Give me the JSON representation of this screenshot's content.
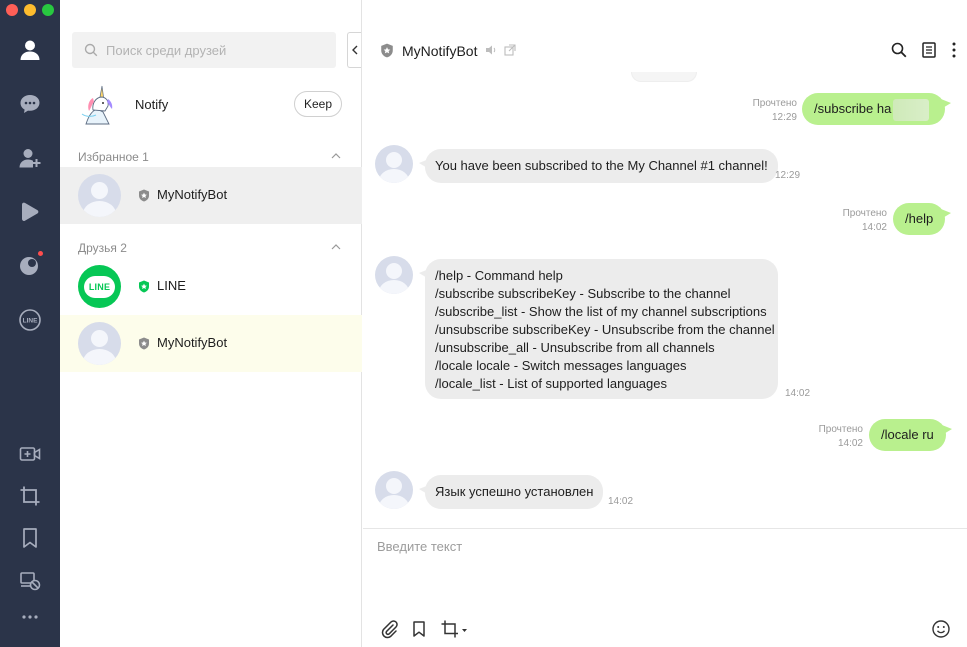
{
  "colors": {
    "rail_bg": "#2b3449",
    "rail_icon": "#a7adbd",
    "rail_active": "#ffffff",
    "out_bubble": "#b9f08e",
    "in_bubble": "#ececec",
    "line_green": "#06c755",
    "notification_dot": "#ff4d4d"
  },
  "rail": {
    "icons": [
      "friends-icon",
      "chats-icon",
      "add-friend-icon",
      "timeline-icon",
      "openchat-icon",
      "line-icon",
      "video-call-icon",
      "screenshot-icon",
      "keep-icon",
      "mute-icon",
      "more-icon"
    ]
  },
  "friends": {
    "search_placeholder": "Поиск среди друзей",
    "notify": {
      "name": "Notify",
      "keep_label": "Keep"
    },
    "favorites_header": "Избранное 1",
    "favorites": [
      {
        "name": "MyNotifyBot"
      }
    ],
    "friends_header": "Друзья 2",
    "list": [
      {
        "name": "LINE",
        "logo_text": "LINE"
      },
      {
        "name": "MyNotifyBot"
      }
    ]
  },
  "chat": {
    "title": "MyNotifyBot",
    "messages": [
      {
        "dir": "out",
        "text": "/subscribe ha",
        "read": "Прочтено",
        "time": "12:29"
      },
      {
        "dir": "in",
        "text": "You have been subscribed to the My Channel #1 channel!",
        "time": "12:29"
      },
      {
        "dir": "out",
        "text": "/help",
        "read": "Прочтено",
        "time": "14:02"
      },
      {
        "dir": "in",
        "lines": [
          "/help - Command help",
          "/subscribe subscribeKey - Subscribe to the channel",
          "/subscribe_list - Show the list of my channel subscriptions",
          "/unsubscribe subscribeKey - Unsubscribe from the channel",
          "/unsubscribe_all - Unsubscribe from all channels",
          "/locale locale - Switch messages languages",
          "/locale_list - List of supported languages"
        ],
        "time": "14:02"
      },
      {
        "dir": "out",
        "text": "/locale ru",
        "read": "Прочтено",
        "time": "14:02"
      },
      {
        "dir": "in",
        "text": "Язык успешно установлен",
        "time": "14:02"
      }
    ],
    "composer_placeholder": "Введите текст"
  }
}
